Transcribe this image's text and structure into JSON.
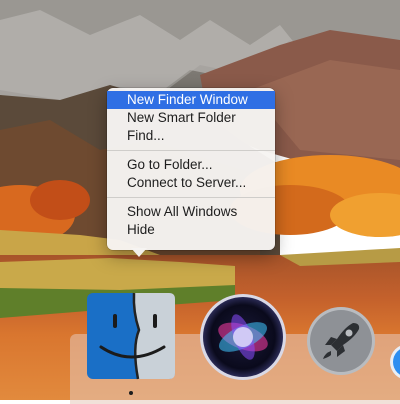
{
  "context_menu": {
    "items": [
      {
        "label": "New Finder Window",
        "selected": true
      },
      {
        "label": "New Smart Folder"
      },
      {
        "label": "Find..."
      },
      {
        "label": "Go to Folder..."
      },
      {
        "label": "Connect to Server..."
      },
      {
        "label": "Show All Windows"
      },
      {
        "label": "Hide"
      }
    ],
    "highlight_color": "#2f6fe4"
  },
  "dock": {
    "icons": [
      "finder-icon",
      "siri-icon",
      "launchpad-icon",
      "safari-icon"
    ],
    "running_app": "finder-icon"
  },
  "wallpaper": {
    "palette": [
      "#7a7670",
      "#e07a2e",
      "#c4612c",
      "#d2b34a"
    ]
  }
}
